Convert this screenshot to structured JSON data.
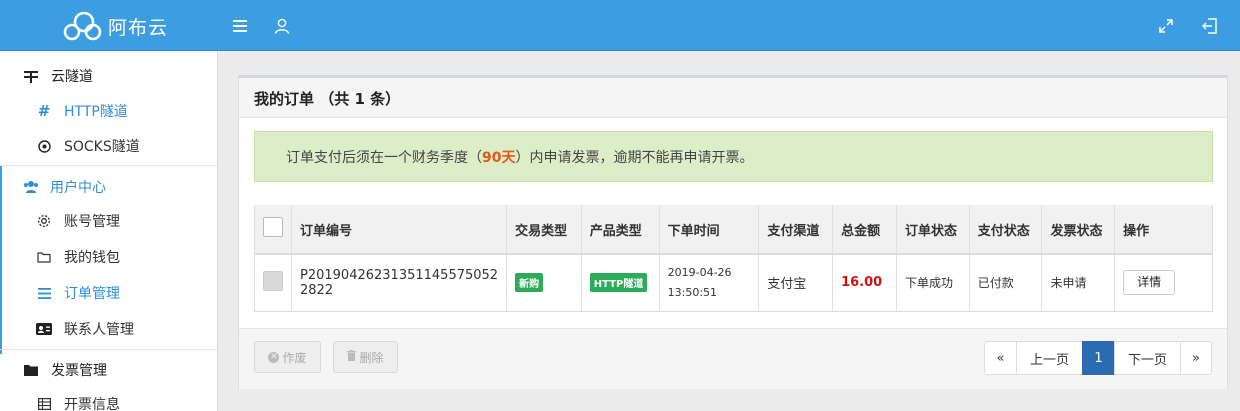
{
  "app": {
    "brand": "阿布云",
    "menu_icon": "hamburger-icon",
    "user_icon": "user-icon",
    "fullscreen_icon": "fullscreen-icon",
    "logout_icon": "logout-icon",
    "accent": "#3c9ee0"
  },
  "sidebar": {
    "groups": [
      {
        "label": "云隧道",
        "icon": "tunnel-icon",
        "items": [
          {
            "label": "HTTP隧道",
            "icon": "hash-icon",
            "active": true
          },
          {
            "label": "SOCKS隧道",
            "icon": "target-icon",
            "active": false
          }
        ]
      },
      {
        "label": "用户中心",
        "icon": "users-icon",
        "active": true,
        "items": [
          {
            "label": "账号管理",
            "icon": "gear-icon",
            "active": false
          },
          {
            "label": "我的钱包",
            "icon": "wallet-icon",
            "active": false
          },
          {
            "label": "订单管理",
            "icon": "list-icon",
            "active": true
          },
          {
            "label": "联系人管理",
            "icon": "contact-card-icon",
            "active": false
          }
        ]
      },
      {
        "label": "发票管理",
        "icon": "folder-icon",
        "items": [
          {
            "label": "开票信息",
            "icon": "table-icon",
            "active": false
          }
        ]
      }
    ]
  },
  "panel": {
    "title": "我的订单 （共 1 条）",
    "alert_before": "订单支付后须在一个财务季度（",
    "alert_highlight": "90天",
    "alert_after": "）内申请发票，逾期不能再申请开票。"
  },
  "table": {
    "columns": [
      "订单编号",
      "交易类型",
      "产品类型",
      "下单时间",
      "支付渠道",
      "总金额",
      "订单状态",
      "支付状态",
      "发票状态",
      "操作"
    ],
    "rows": [
      {
        "order_no": "P20190426231351145575052​2822",
        "trade_type": "新购",
        "product_type": "HTTP隧道",
        "date": "2019-04-26",
        "time": "13:50:51",
        "channel": "支付宝",
        "amount": "16.00",
        "order_status": "下单成功",
        "pay_status": "已付款",
        "invoice_status": "未申请",
        "action": "详情"
      }
    ]
  },
  "footer": {
    "void_label": "作废",
    "delete_label": "删除",
    "pager": {
      "first": "«",
      "prev": "上一页",
      "current": "1",
      "next": "下一页",
      "last": "»"
    }
  }
}
